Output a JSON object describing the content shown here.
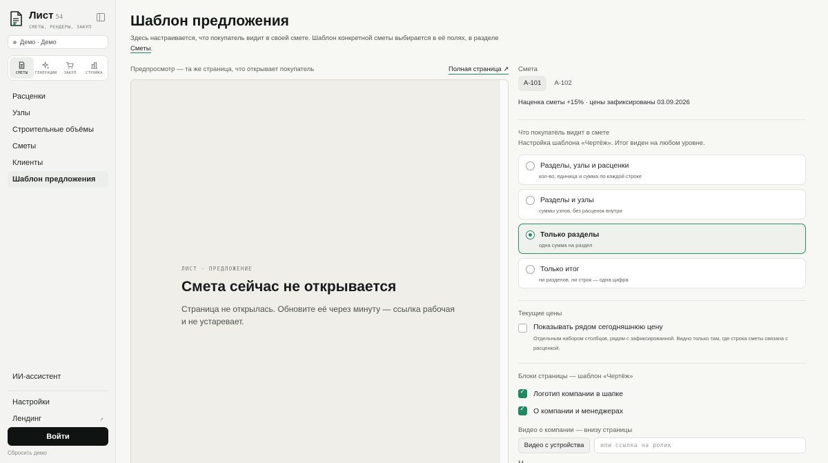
{
  "sidebar": {
    "brand": {
      "title": "Лист",
      "count": "54",
      "subtitle": "СМЕТЫ, РЕНДЕРЫ, ЗАКУП"
    },
    "workspace": "Демо · Демо",
    "modes": [
      {
        "label": "СМЕТЫ",
        "icon": "document-icon",
        "active": true
      },
      {
        "label": "ГЕНЕРАЦИИ",
        "icon": "sparkle-icon",
        "active": false
      },
      {
        "label": "ЗАКУП",
        "icon": "cart-icon",
        "active": false
      },
      {
        "label": "СТРОЙКА",
        "icon": "building-icon",
        "active": false
      }
    ],
    "nav": [
      {
        "label": "Расценки",
        "active": false
      },
      {
        "label": "Узлы",
        "active": false
      },
      {
        "label": "Строительные объёмы",
        "active": false
      },
      {
        "label": "Сметы",
        "active": false
      },
      {
        "label": "Клиенты",
        "active": false
      },
      {
        "label": "Шаблон предложения",
        "active": true
      }
    ],
    "assistant": "ИИ-ассистент",
    "settings": "Настройки",
    "landing": "Лендинг",
    "landing_arrow": "↗",
    "login": "Войти",
    "reset": "Сбросить демо"
  },
  "main": {
    "title": "Шаблон предложения",
    "description": "Здесь настраивается, что покупатель видит в своей смете. Шаблон конкретной сметы выбирается в её полях, в разделе",
    "description_link": "Сметы",
    "description_end": ".",
    "preview_label": "Предпросмотр — та же страница, что открывает покупатель",
    "full_page_link": "Полная страница ↗",
    "preview": {
      "eyebrow": "ЛИСТ · ПРЕДЛОЖЕНИЕ",
      "title": "Смета сейчас не открывается",
      "text": "Страница не открылась. Обновите её через минуту — ссылка рабочая и не устаревает."
    }
  },
  "panel": {
    "estimate_label": "Смета",
    "estimates": [
      {
        "label": "А-101",
        "active": true
      },
      {
        "label": "А-102",
        "active": false
      }
    ],
    "markup_text": "Наценка сметы +15% · цены зафиксированы 03.09.2026",
    "visibility_title": "Что покупатель видит в смете",
    "visibility_subtitle": "Настройка шаблона «Чертёж». Итог виден на любом уровне.",
    "options": [
      {
        "title": "Разделы, узлы и расценки",
        "subtitle": "кол-во, единица и сумма по каждой строке",
        "selected": false
      },
      {
        "title": "Разделы и узлы",
        "subtitle": "суммы узлов, без расценок внутри",
        "selected": false
      },
      {
        "title": "Только разделы",
        "subtitle": "одна сумма на раздел",
        "selected": true
      },
      {
        "title": "Только итог",
        "subtitle": "ни разделов, ни строк — одна цифра",
        "selected": false
      }
    ],
    "current_prices": {
      "label": "Текущие цены",
      "checkbox_label": "Показывать рядом сегодняшнюю цену",
      "checked": false,
      "description": "Отдельным набором столбцов, рядом с зафиксированной. Видно только там, где строка сметы связана с расценкой."
    },
    "blocks": {
      "label": "Блоки страницы — шаблон «Чертёж»",
      "items": [
        {
          "label": "Логотип компании в шапке",
          "checked": true
        },
        {
          "label": "О компании и менеджерах",
          "checked": true
        }
      ]
    },
    "video": {
      "label": "Видео о компании — внизу страницы",
      "button": "Видео с устройства",
      "input_placeholder": "или ссылка на ролик",
      "input_value": ""
    },
    "next_section_label": "М"
  },
  "colors": {
    "accent": "#1f8a5f",
    "sidebar_bg": "#f3f4f1",
    "main_bg": "#f7f7f4",
    "preview_bg": "#efeee9",
    "button_dark": "#0f1412"
  }
}
